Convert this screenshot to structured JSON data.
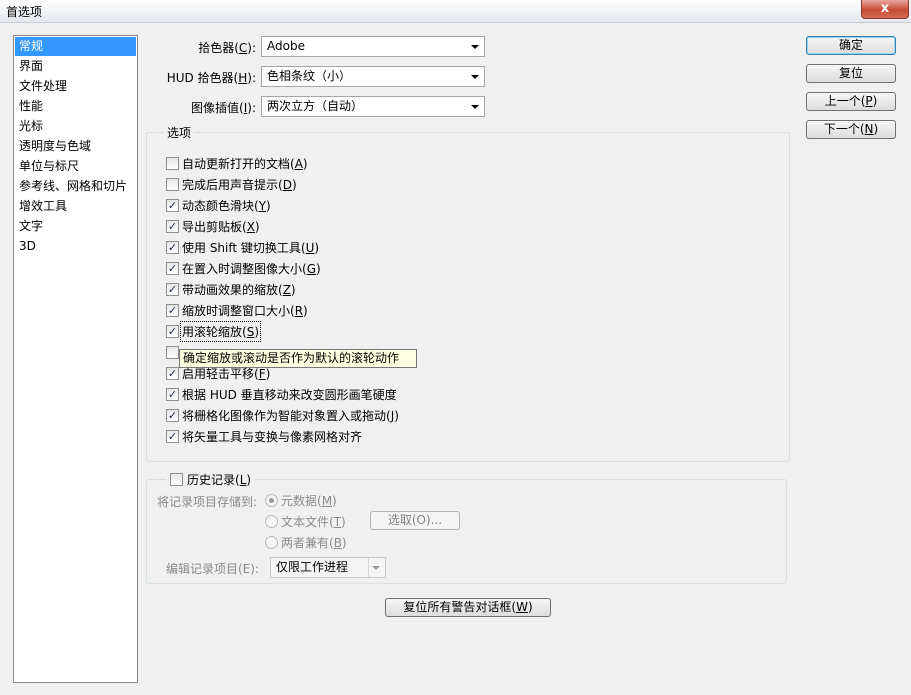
{
  "window": {
    "title": "首选项",
    "close_label": "x"
  },
  "sidebar": {
    "items": [
      {
        "label": "常规",
        "selected": true
      },
      {
        "label": "界面"
      },
      {
        "label": "文件处理"
      },
      {
        "label": "性能"
      },
      {
        "label": "光标"
      },
      {
        "label": "透明度与色域"
      },
      {
        "label": "单位与标尺"
      },
      {
        "label": "参考线、网格和切片"
      },
      {
        "label": "增效工具"
      },
      {
        "label": "文字"
      },
      {
        "label": "3D"
      }
    ]
  },
  "fields": {
    "color_picker": {
      "label": "拾色器(",
      "key": "C",
      "label_end": "):",
      "value": "Adobe"
    },
    "hud_picker": {
      "label": "HUD 拾色器(",
      "key": "H",
      "label_end": "):",
      "value": "色相条纹（小）"
    },
    "interpolation": {
      "label": "图像插值(",
      "key": "I",
      "label_end": "):",
      "value": "两次立方（自动）"
    }
  },
  "options": {
    "legend": "选项",
    "items": [
      {
        "text": "自动更新打开的文档(",
        "key": "A",
        "end": ")",
        "checked": false
      },
      {
        "text": "完成后用声音提示(",
        "key": "D",
        "end": ")",
        "checked": false
      },
      {
        "text": "动态颜色滑块(",
        "key": "Y",
        "end": ")",
        "checked": true
      },
      {
        "text": "导出剪贴板(",
        "key": "X",
        "end": ")",
        "checked": true
      },
      {
        "text": "使用 Shift 键切换工具(",
        "key": "U",
        "end": ")",
        "checked": true
      },
      {
        "text": "在置入时调整图像大小(",
        "key": "G",
        "end": ")",
        "checked": true
      },
      {
        "text": "带动画效果的缩放(",
        "key": "Z",
        "end": ")",
        "checked": true
      },
      {
        "text": "缩放时调整窗口大小(",
        "key": "R",
        "end": ")",
        "checked": true
      },
      {
        "text": "用滚轮缩放(",
        "key": "S",
        "end": ")",
        "checked": true,
        "focused": true
      },
      {
        "text": "",
        "key": "",
        "end": "",
        "checked": false
      },
      {
        "text": "启用轻击平移(",
        "key": "F",
        "end": ")",
        "checked": true
      },
      {
        "text": "根据 HUD 垂直移动来改变圆形画笔硬度",
        "key": "",
        "end": "",
        "checked": true
      },
      {
        "text": "将栅格化图像作为智能对象置入或拖动(",
        "key": "J",
        "end": ")",
        "checked": true
      },
      {
        "text": "将矢量工具与变换与像素网格对齐",
        "key": "",
        "end": "",
        "checked": true
      }
    ]
  },
  "tooltip": "确定缩放或滚动是否作为默认的滚轮动作",
  "history": {
    "label": "历史记录(",
    "key": "L",
    "label_end": ")",
    "checked": false,
    "save_to_label": "将记录项目存储到:",
    "radios": [
      {
        "label": "元数据(",
        "key": "M",
        "end": ")",
        "checked": true
      },
      {
        "label": "文本文件(",
        "key": "T",
        "end": ")",
        "checked": false
      },
      {
        "label": "两者兼有(",
        "key": "B",
        "end": ")",
        "checked": false
      }
    ],
    "choose_button": "选取(O)...",
    "edit_label": "编辑记录项目(E):",
    "edit_value": "仅限工作进程"
  },
  "buttons": {
    "ok": "确定",
    "reset": "复位",
    "prev": "上一个(",
    "prev_key": "P",
    "next": "下一个(",
    "next_key": "N",
    "reset_warnings": "复位所有警告对话框(",
    "reset_warnings_key": "W",
    "paren_close": ")"
  }
}
